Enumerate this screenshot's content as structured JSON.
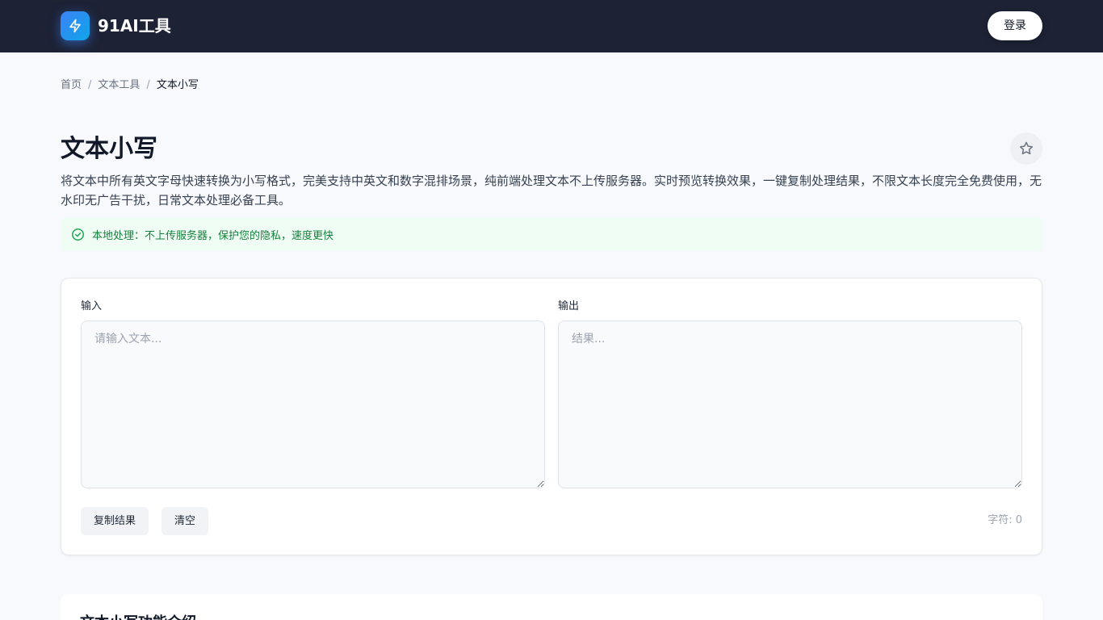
{
  "header": {
    "brand": "91AI工具",
    "login_label": "登录"
  },
  "breadcrumb": {
    "home": "首页",
    "category": "文本工具",
    "current": "文本小写",
    "separator": "/"
  },
  "page": {
    "title": "文本小写",
    "description": "将文本中所有英文字母快速转换为小写格式，完美支持中英文和数字混排场景，纯前端处理文本不上传服务器。实时预览转换效果，一键复制处理结果，不限文本长度完全免费使用，无水印无广告干扰，日常文本处理必备工具。",
    "notice": "本地处理：不上传服务器，保护您的隐私，速度更快"
  },
  "tool": {
    "input_label": "输入",
    "input_placeholder": "请输入文本...",
    "input_value": "",
    "output_label": "输出",
    "output_placeholder": "结果...",
    "output_value": "",
    "copy_label": "复制结果",
    "clear_label": "清空",
    "char_count": "字符: 0"
  },
  "intro": {
    "title": "文本小写功能介绍"
  },
  "icons": {
    "logo": "lightning-icon",
    "favorite": "star-icon",
    "notice": "check-circle-icon"
  },
  "colors": {
    "topbar": "#1d2235",
    "accent": "#3b82f6",
    "success": "#15803d",
    "success_bg": "#f0fdf4"
  }
}
